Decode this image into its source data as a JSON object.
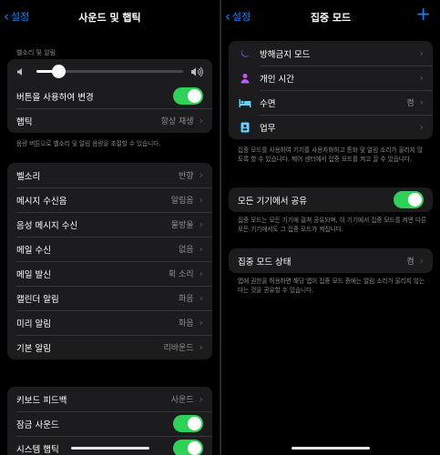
{
  "left": {
    "back_label": "설정",
    "title": "사운드 및 햅틱",
    "volume_section_label": "벨소리 및 알림",
    "volume_level": 0.15,
    "change_with_buttons_label": "버튼을 사용하여 변경",
    "haptics_label": "햅틱",
    "haptics_value": "항상 재생",
    "volume_footnote": "음량 버튼으로 벨소리 및 알림 음량을 조절할 수 있습니다.",
    "sounds": [
      {
        "label": "벨소리",
        "value": "반향"
      },
      {
        "label": "메시지 수신음",
        "value": "알림음"
      },
      {
        "label": "음성 메시지 수신",
        "value": "물방울"
      },
      {
        "label": "메일 수신",
        "value": "없음"
      },
      {
        "label": "메일 발신",
        "value": "휙 소리"
      },
      {
        "label": "캘린더 알림",
        "value": "화음"
      },
      {
        "label": "미리 알림",
        "value": "화음"
      },
      {
        "label": "기본 알림",
        "value": "리바운드"
      }
    ],
    "keyboard_feedback_label": "키보드 피드백",
    "keyboard_feedback_value": "사운드",
    "lock_sound_label": "잠금 사운드",
    "system_haptics_label": "시스템 햅틱"
  },
  "right": {
    "back_label": "설정",
    "title": "집중 모드",
    "focus_modes": [
      {
        "label": "방해금지 모드",
        "value": "",
        "icon": "moon-icon",
        "color": "#5e5ce6"
      },
      {
        "label": "개인 시간",
        "value": "",
        "icon": "person-icon",
        "color": "#bf5af2"
      },
      {
        "label": "수면",
        "value": "켬",
        "icon": "bed-icon",
        "color": "#64d2ff"
      },
      {
        "label": "업무",
        "value": "",
        "icon": "badge-icon",
        "color": "#64d2ff"
      }
    ],
    "focus_footnote": "집중 모드를 사용하여 기기를 사용자화하고 통화 및 알림 소리가 울리지 않도록 할 수 있습니다. 제어 센터에서 집중 모드를 켜고 끌 수 있습니다.",
    "share_label": "모든 기기에서 공유",
    "share_footnote": "집중 모드는 모든 기기에 걸쳐 공유되며, 이 기기에서 집중 모드를 켜면 다른 모든 기기에서도 그 집중 모드가 켜집니다.",
    "status_label": "집중 모드 상태",
    "status_value": "켬",
    "status_footnote": "앱에 권한을 허용하면 해당 앱이 집중 모드 중에는 알림 소리가 울리지 않는다는 것을 공유할 수 있습니다."
  }
}
